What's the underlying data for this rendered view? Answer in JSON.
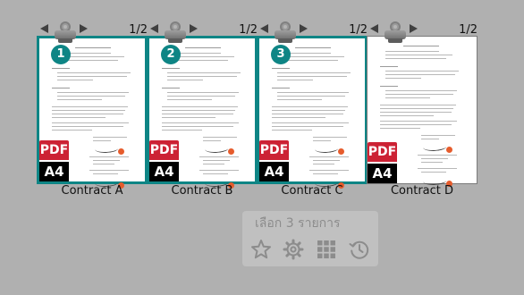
{
  "documents": [
    {
      "name": "Contract A",
      "page_indicator": "1/2",
      "order_badge": "1",
      "file_type": "PDF",
      "page_size": "A4",
      "selected": true
    },
    {
      "name": "Contract B",
      "page_indicator": "1/2",
      "order_badge": "2",
      "file_type": "PDF",
      "page_size": "A4",
      "selected": true
    },
    {
      "name": "Contract C",
      "page_indicator": "1/2",
      "order_badge": "3",
      "file_type": "PDF",
      "page_size": "A4",
      "selected": true
    },
    {
      "name": "Contract D",
      "page_indicator": "1/2",
      "order_badge": "",
      "file_type": "PDF",
      "page_size": "A4",
      "selected": false
    }
  ],
  "selection_panel": {
    "title": "เลือก 3 รายการ",
    "actions": [
      {
        "icon": "star-icon"
      },
      {
        "icon": "gear-icon"
      },
      {
        "icon": "grid-icon"
      },
      {
        "icon": "history-icon"
      }
    ]
  },
  "colors": {
    "background": "#b0b0b0",
    "selected_border": "#0e8585",
    "badge": "#0e8585",
    "pdf_tag": "#cc2234",
    "size_tag": "#000000",
    "panel": "#c0c0c0",
    "panel_icon": "#8c8c8c"
  }
}
